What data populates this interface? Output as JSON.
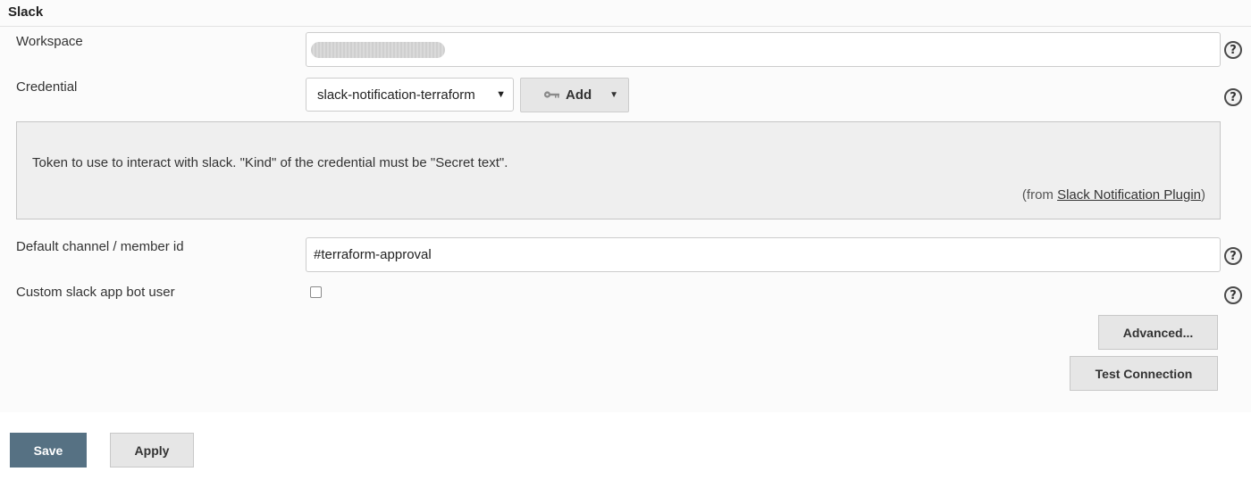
{
  "section": {
    "title": "Slack"
  },
  "workspace": {
    "label": "Workspace",
    "value": ""
  },
  "credential": {
    "label": "Credential",
    "selected": "slack-notification-terraform",
    "add_label": "Add"
  },
  "help_box": {
    "text": "Token to use to interact with slack. \"Kind\" of the credential must be \"Secret text\".",
    "from_prefix": "(from ",
    "from_link": "Slack Notification Plugin",
    "from_suffix": ")"
  },
  "channel": {
    "label": "Default channel / member id",
    "value": "#terraform-approval"
  },
  "bot_user": {
    "label": "Custom slack app bot user",
    "checked": false
  },
  "buttons": {
    "advanced": "Advanced...",
    "test": "Test Connection",
    "save": "Save",
    "apply": "Apply"
  },
  "icons": {
    "help": "help-icon",
    "key": "key-icon",
    "select_caret": "caret-down-icon",
    "dropdown": "dropdown-arrow-icon"
  },
  "colors": {
    "save_bg": "#567183",
    "button_bg": "#e6e6e6",
    "help_box_bg": "#efefef"
  }
}
